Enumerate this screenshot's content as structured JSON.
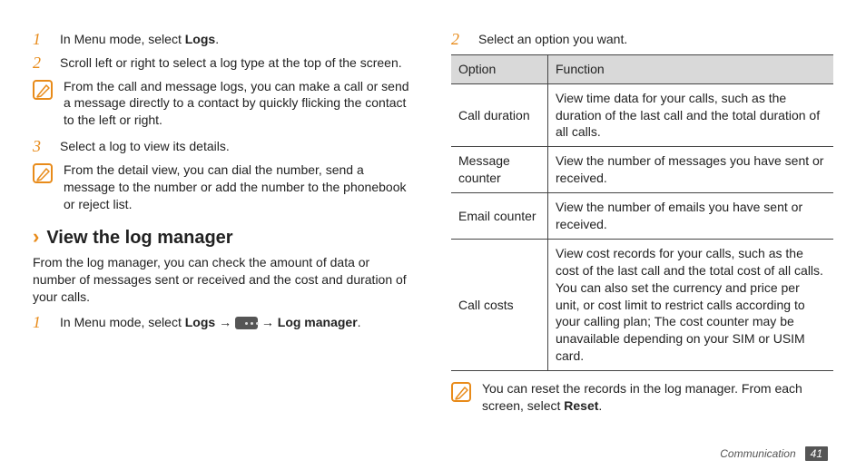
{
  "left": {
    "step1_pre": "In Menu mode, select ",
    "step1_bold": "Logs",
    "step1_post": ".",
    "step2": "Scroll left or right to select a log type at the top of the screen.",
    "note1": "From the call and message logs, you can make a call or send a message directly to a contact by quickly flicking the contact to the left or right.",
    "step3": "Select a log to view its details.",
    "note2": "From the detail view, you can dial the number, send a message to the number or add the number to the phonebook or reject list.",
    "sec_title": "View the log manager",
    "sec_para": "From the log manager, you can check the amount of data or number of messages sent or received and the cost and duration of your calls.",
    "sec_step1_pre": "In Menu mode, select ",
    "sec_step1_b1": "Logs",
    "sec_step1_arrow": " → ",
    "sec_step1_b2": "Log manager",
    "sec_step1_post": "."
  },
  "right": {
    "step2": "Select an option you want.",
    "hdr_option": "Option",
    "hdr_function": "Function",
    "rows": [
      {
        "opt": "Call duration",
        "fn": "View time data for your calls, such as the duration of the last call and the total duration of all calls."
      },
      {
        "opt": "Message counter",
        "fn": "View the number of messages you have sent or received."
      },
      {
        "opt": "Email counter",
        "fn": "View the number of emails you have sent or received."
      },
      {
        "opt": "Call costs",
        "fn": "View cost records for your calls, such as the cost of the last call and the total cost of all calls. You can also set the currency and price per unit, or cost limit to restrict calls according to your calling plan; The cost counter may be unavailable depending on your SIM or USIM card."
      }
    ],
    "note_pre": "You can reset the records in the log manager. From each screen, select ",
    "note_bold": "Reset",
    "note_post": "."
  },
  "footer": {
    "section": "Communication",
    "page": "41"
  }
}
